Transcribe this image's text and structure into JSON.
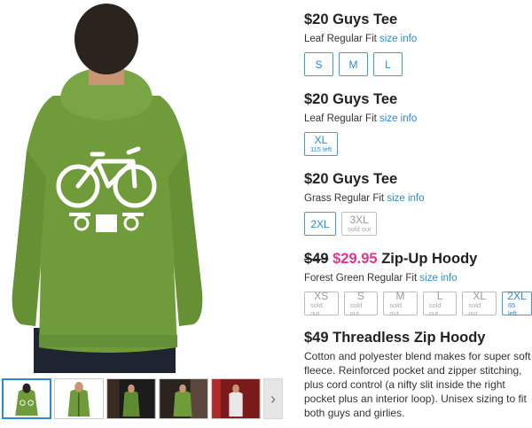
{
  "colors": {
    "accent_blue": "#2a8ad8",
    "sale_pink": "#e6338c",
    "hoodie_green": "#6f9b3b",
    "sold_gray": "#999999"
  },
  "gallery": {
    "main_image": "model-back-green-hoodie-bike-print",
    "thumbnails": [
      {
        "name": "thumb-back-view",
        "active": true
      },
      {
        "name": "thumb-front-view",
        "active": false
      },
      {
        "name": "thumb-dark-scene",
        "active": false
      },
      {
        "name": "thumb-outdoor-scene",
        "active": false
      },
      {
        "name": "thumb-red-scene",
        "active": false
      }
    ],
    "next_icon": "chevron-right-icon",
    "next_glyph": "›"
  },
  "products": [
    {
      "price": "$20",
      "title": "Guys Tee",
      "fit": "Leaf Regular Fit",
      "size_info": "size info",
      "sizes": [
        {
          "label": "S",
          "note": "",
          "sold": false
        },
        {
          "label": "M",
          "note": "",
          "sold": false
        },
        {
          "label": "L",
          "note": "",
          "sold": false
        }
      ]
    },
    {
      "price": "$20",
      "title": "Guys Tee",
      "fit": "Leaf Regular Fit",
      "size_info": "size info",
      "sizes": [
        {
          "label": "XL",
          "note": "115 left",
          "sold": false
        }
      ]
    },
    {
      "price": "$20",
      "title": "Guys Tee",
      "fit": "Grass Regular Fit",
      "size_info": "size info",
      "sizes": [
        {
          "label": "2XL",
          "note": "",
          "sold": false
        },
        {
          "label": "3XL",
          "note": "sold out",
          "sold": true
        }
      ]
    },
    {
      "old_price": "$49",
      "sale_price": "$29.95",
      "title": "Zip-Up Hoody",
      "fit": "Forest Green Regular Fit",
      "size_info": "size info",
      "sizes": [
        {
          "label": "XS",
          "note": "sold out",
          "sold": true
        },
        {
          "label": "S",
          "note": "sold out",
          "sold": true
        },
        {
          "label": "M",
          "note": "sold out",
          "sold": true
        },
        {
          "label": "L",
          "note": "sold out",
          "sold": true
        },
        {
          "label": "XL",
          "note": "sold out",
          "sold": true
        },
        {
          "label": "2XL",
          "note": "65 left",
          "sold": false
        }
      ]
    }
  ],
  "description": {
    "title": "$49 Threadless Zip Hoody",
    "text": "Cotton and polyester blend makes for super soft fleece. Reinforced pocket and zipper stitching, plus cord control (a nifty slit inside the right pocket plus an interior loop). Unisex sizing to fit both guys and girlies."
  }
}
